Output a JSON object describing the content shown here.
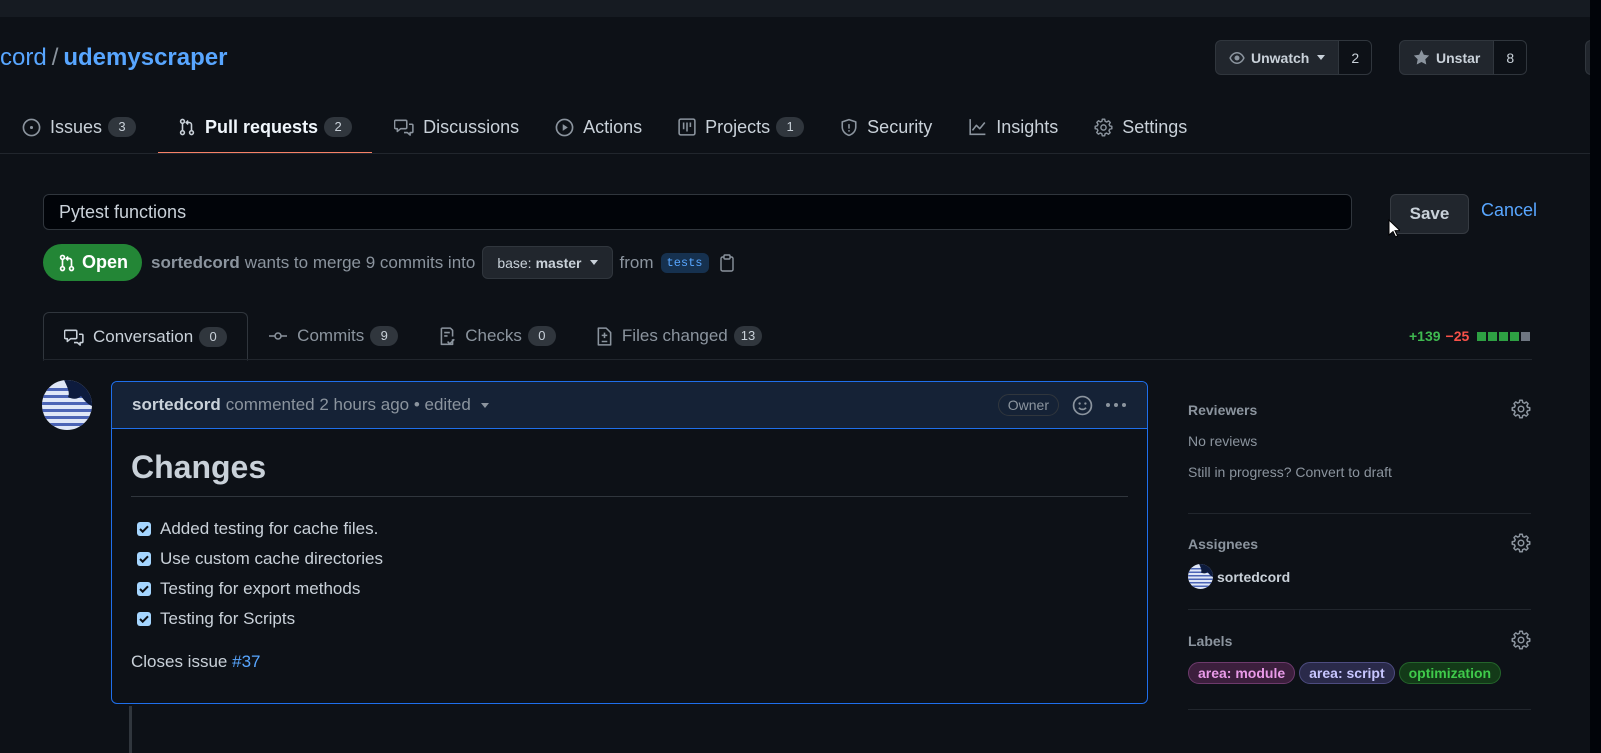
{
  "repo": {
    "owner": "cord",
    "separator": "/",
    "name": "udemyscraper"
  },
  "actions": {
    "watch": {
      "label": "Unwatch",
      "count": "2"
    },
    "star": {
      "label": "Unstar",
      "count": "8"
    }
  },
  "nav": {
    "items": [
      {
        "label": "Issues",
        "count": "3"
      },
      {
        "label": "Pull requests",
        "count": "2"
      },
      {
        "label": "Discussions"
      },
      {
        "label": "Actions"
      },
      {
        "label": "Projects",
        "count": "1"
      },
      {
        "label": "Security"
      },
      {
        "label": "Insights"
      },
      {
        "label": "Settings"
      }
    ]
  },
  "pr": {
    "title_value": "Pytest functions",
    "save_label": "Save",
    "cancel_label": "Cancel",
    "state": "Open",
    "author": "sortedcord",
    "merge_text": "wants to merge 9 commits into",
    "base_prefix": "base:",
    "base_branch": "master",
    "from_text": "from",
    "head_branch": "tests"
  },
  "tabs": [
    {
      "label": "Conversation",
      "count": "0"
    },
    {
      "label": "Commits",
      "count": "9"
    },
    {
      "label": "Checks",
      "count": "0"
    },
    {
      "label": "Files changed",
      "count": "13"
    }
  ],
  "diffstat": {
    "additions": "+139",
    "deletions": "−25"
  },
  "comment": {
    "author": "sortedcord",
    "meta": "commented 2 hours ago • edited",
    "badge": "Owner",
    "heading": "Changes",
    "tasks": [
      "Added testing for cache files.",
      "Use custom cache directories",
      "Testing for export methods",
      "Testing for Scripts"
    ],
    "closes_text": "Closes issue",
    "closes_link": "#37"
  },
  "sidebar": {
    "reviewers": {
      "title": "Reviewers",
      "empty": "No reviews",
      "hint": "Still in progress? Convert to draft"
    },
    "assignees": {
      "title": "Assignees",
      "user": "sortedcord"
    },
    "labels": {
      "title": "Labels",
      "items": [
        {
          "name": "area: module",
          "color": "#e99ae8"
        },
        {
          "name": "area: script",
          "color": "#c7c6ff"
        },
        {
          "name": "optimization",
          "color": "#3fca4b"
        }
      ]
    }
  },
  "colors": {
    "background": "#0d1117",
    "accent_blue": "#58a6ff",
    "open_green": "#238636",
    "tab_underline": "#f78166",
    "additions": "#3fb950",
    "deletions": "#f85149"
  }
}
